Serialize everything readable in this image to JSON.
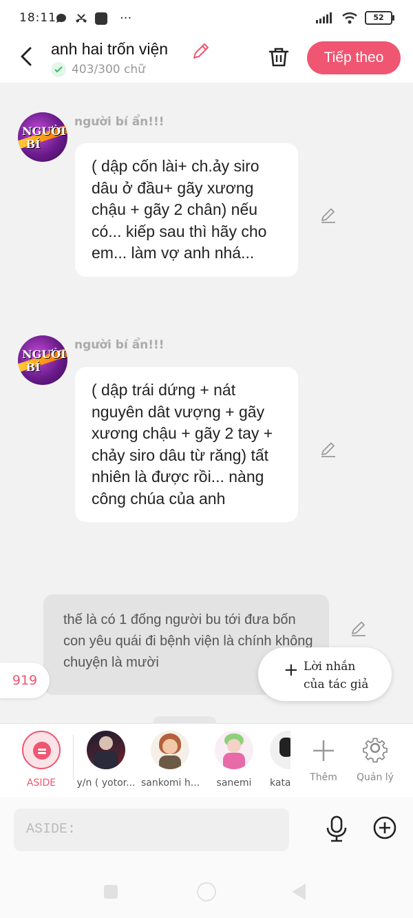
{
  "status": {
    "time": "18:11",
    "battery": "52",
    "more": "···"
  },
  "header": {
    "title": "anh hai trốn viện",
    "word_count": "403/300 chữ",
    "next_label": "Tiếp theo"
  },
  "messages": [
    {
      "sender": "người bí ẩn!!!",
      "text": "( dập cốn lài+ ch.ảy siro dâu ở đầu+ gãy xương chậu + gãy 2 chân) nếu có... kiếp sau thì hãy cho em... làm vợ anh nhá..."
    },
    {
      "sender": "người bí ẩn!!!",
      "text": "( dập trái dứng + nát nguyên dât vượng + gãy xương chậu + gãy 2 tay + chảy siro dâu từ răng) tất nhiên là được rồi... nàng công chúa của anh"
    }
  ],
  "narration": {
    "text": "thế là có 1 đống người bu tới đưa bốn con yêu quái đi bệnh viện là chính không chuyện là mười"
  },
  "count_badge": "919",
  "author_note": {
    "line1": "Lời nhắn",
    "line2": "của tác giả"
  },
  "characters": [
    {
      "label": "ASIDE"
    },
    {
      "label": "y/n ( yotor..."
    },
    {
      "label": "sankomi h..."
    },
    {
      "label": "sanemi"
    },
    {
      "label": "kata"
    }
  ],
  "char_actions": {
    "add_label": "Thêm",
    "manage_label": "Quản lý"
  },
  "input": {
    "placeholder": "ASIDE:"
  },
  "colors": {
    "accent": "#f05572",
    "background": "#f2f2f2",
    "bubble": "#ffffff",
    "narration_bg": "#e3e3e3"
  }
}
